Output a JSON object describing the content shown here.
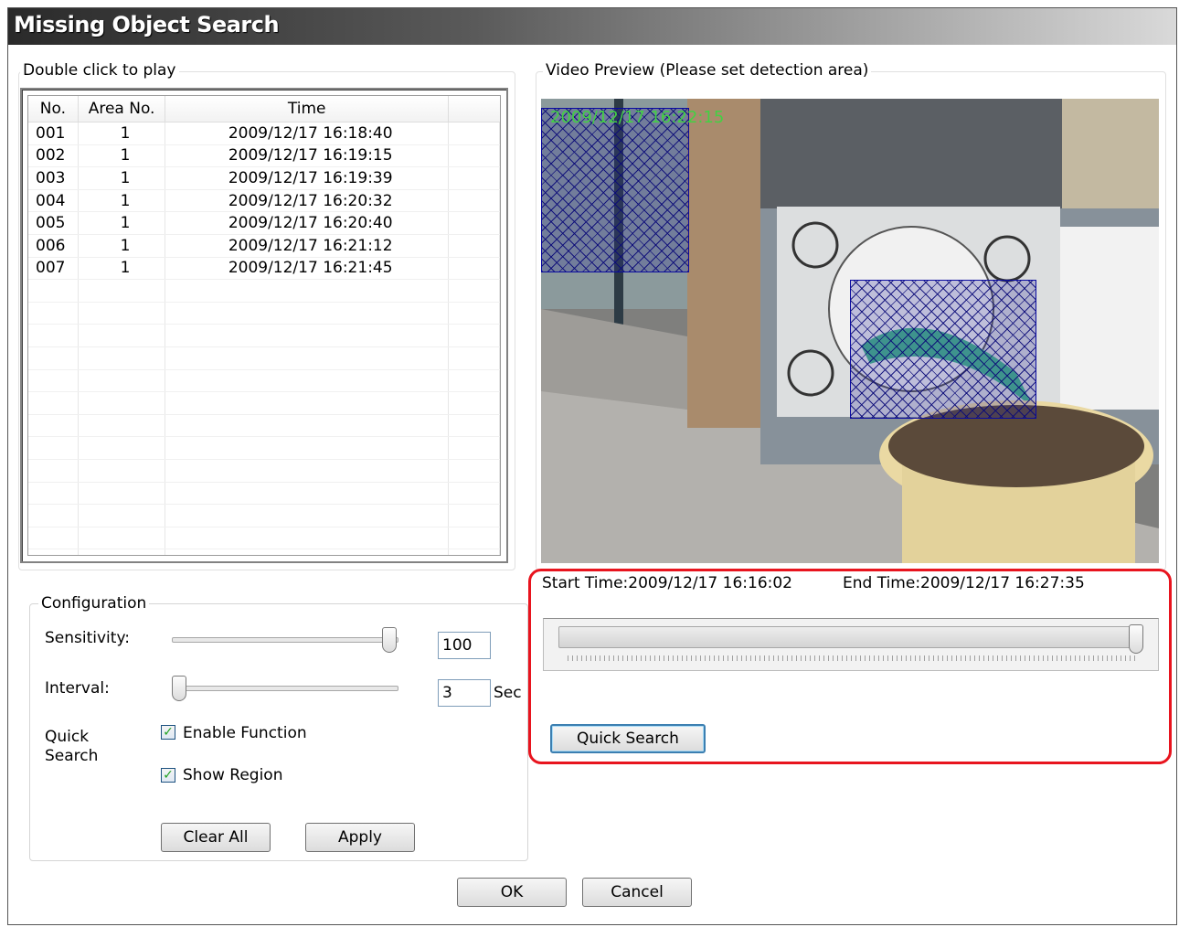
{
  "window": {
    "title": "Missing Object Search"
  },
  "results": {
    "group_label": "Double click to play",
    "columns": [
      "No.",
      "Area No.",
      "Time"
    ],
    "rows": [
      {
        "no": "001",
        "area": "1",
        "time": "2009/12/17 16:18:40"
      },
      {
        "no": "002",
        "area": "1",
        "time": "2009/12/17 16:19:15"
      },
      {
        "no": "003",
        "area": "1",
        "time": "2009/12/17 16:19:39"
      },
      {
        "no": "004",
        "area": "1",
        "time": "2009/12/17 16:20:32"
      },
      {
        "no": "005",
        "area": "1",
        "time": "2009/12/17 16:20:40"
      },
      {
        "no": "006",
        "area": "1",
        "time": "2009/12/17 16:21:12"
      },
      {
        "no": "007",
        "area": "1",
        "time": "2009/12/17 16:21:45"
      }
    ]
  },
  "config": {
    "group_label": "Configuration",
    "sensitivity_label": "Sensitivity:",
    "sensitivity_value": "100",
    "sensitivity_level": 1.0,
    "interval_label": "Interval:",
    "interval_value": "3",
    "interval_level": 0.0,
    "interval_unit": "Sec",
    "quick_search_label_1": "Quick",
    "quick_search_label_2": "Search",
    "enable_function_label": "Enable Function",
    "enable_function_checked": true,
    "show_region_label": "Show Region",
    "show_region_checked": true,
    "clear_all_label": "Clear All",
    "apply_label": "Apply"
  },
  "preview": {
    "group_label": "Video Preview (Please set detection area)",
    "osd_timestamp": "2009/12/17 16:22:15",
    "start_time": "Start Time:2009/12/17 16:16:02",
    "end_time": "End Time:2009/12/17 16:27:35",
    "timeline_level": 1.0,
    "quick_search_button": "Quick Search"
  },
  "footer": {
    "ok_label": "OK",
    "cancel_label": "Cancel"
  },
  "colors": {
    "highlight": "#e8141e",
    "detection_area": "#0a0aa0"
  },
  "icons": {
    "checkbox": "checkmark-icon"
  }
}
